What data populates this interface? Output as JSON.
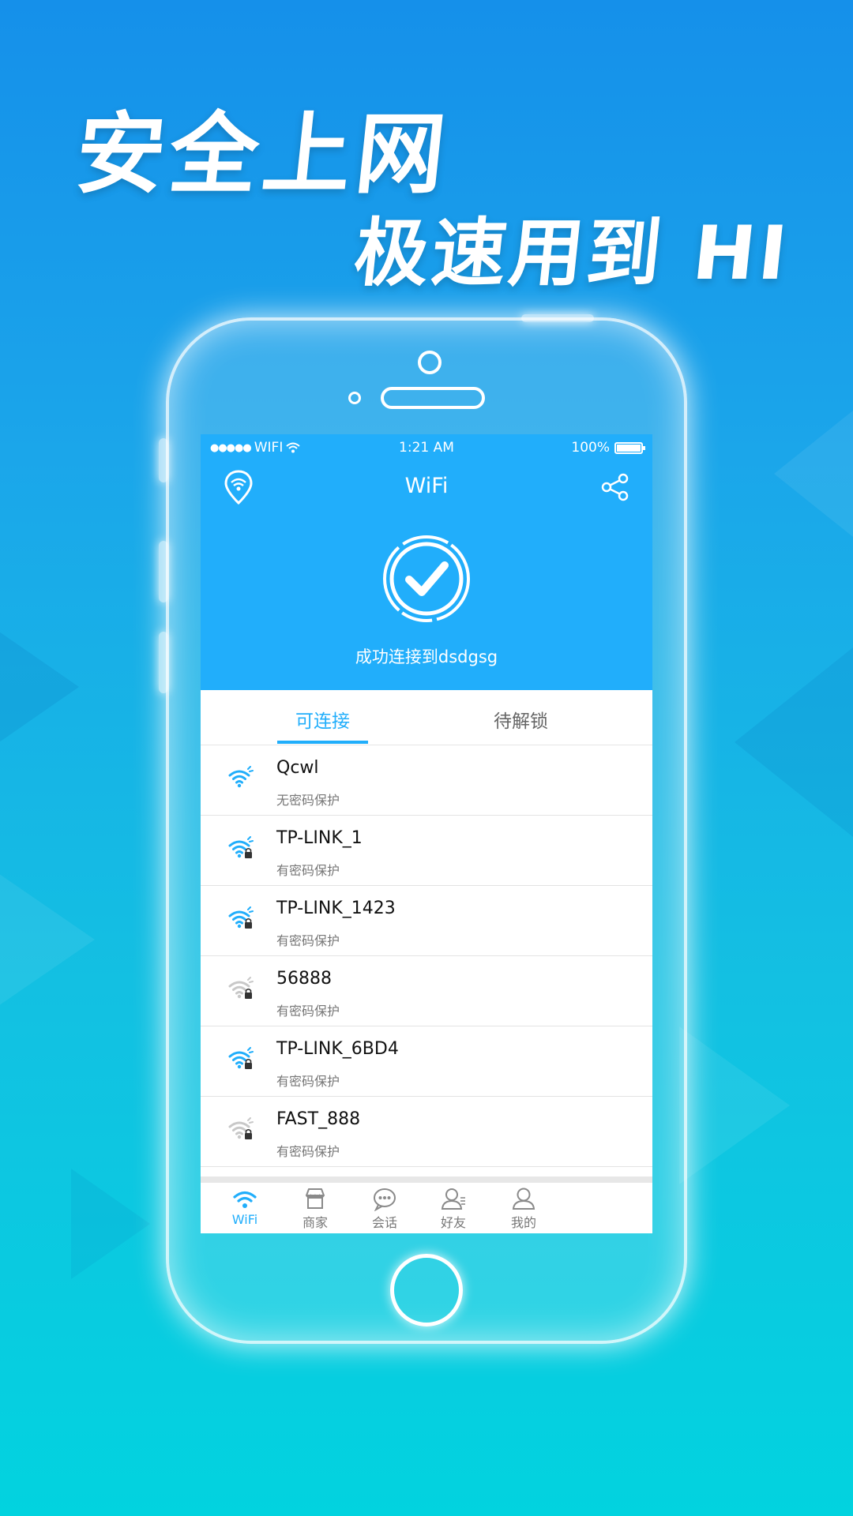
{
  "promo": {
    "headline_line1": "安全上网",
    "headline_line2": "极速用到 HI"
  },
  "status_bar": {
    "signal_dots": "●●●●●",
    "carrier": "WIFI",
    "time": "1:21 AM",
    "battery": "100%"
  },
  "nav": {
    "title": "WiFi"
  },
  "status": {
    "connected_text": "成功连接到dsdgsg"
  },
  "tabs": {
    "available": "可连接",
    "locked": "待解锁"
  },
  "networks": [
    {
      "ssid": "Qcwl",
      "security": "无密码保护",
      "strength": "strong",
      "locked": false
    },
    {
      "ssid": "TP-LINK_1",
      "security": "有密码保护",
      "strength": "strong",
      "locked": true
    },
    {
      "ssid": "TP-LINK_1423",
      "security": "有密码保护",
      "strength": "strong",
      "locked": true
    },
    {
      "ssid": "56888",
      "security": "有密码保护",
      "strength": "weak",
      "locked": true
    },
    {
      "ssid": "TP-LINK_6BD4",
      "security": "有密码保护",
      "strength": "strong",
      "locked": true
    },
    {
      "ssid": "FAST_888",
      "security": "有密码保护",
      "strength": "weak",
      "locked": true
    }
  ],
  "bottom_tabs": [
    {
      "label": "WiFi",
      "icon": "wifi-icon",
      "active": true
    },
    {
      "label": "商家",
      "icon": "shop-icon",
      "active": false
    },
    {
      "label": "会话",
      "icon": "chat-icon",
      "active": false
    },
    {
      "label": "好友",
      "icon": "friends-icon",
      "active": false
    },
    {
      "label": "我的",
      "icon": "profile-icon",
      "active": false
    }
  ],
  "colors": {
    "accent": "#21aefb",
    "wifi_strong": "#21aefb",
    "wifi_weak": "#c8c8c8"
  }
}
